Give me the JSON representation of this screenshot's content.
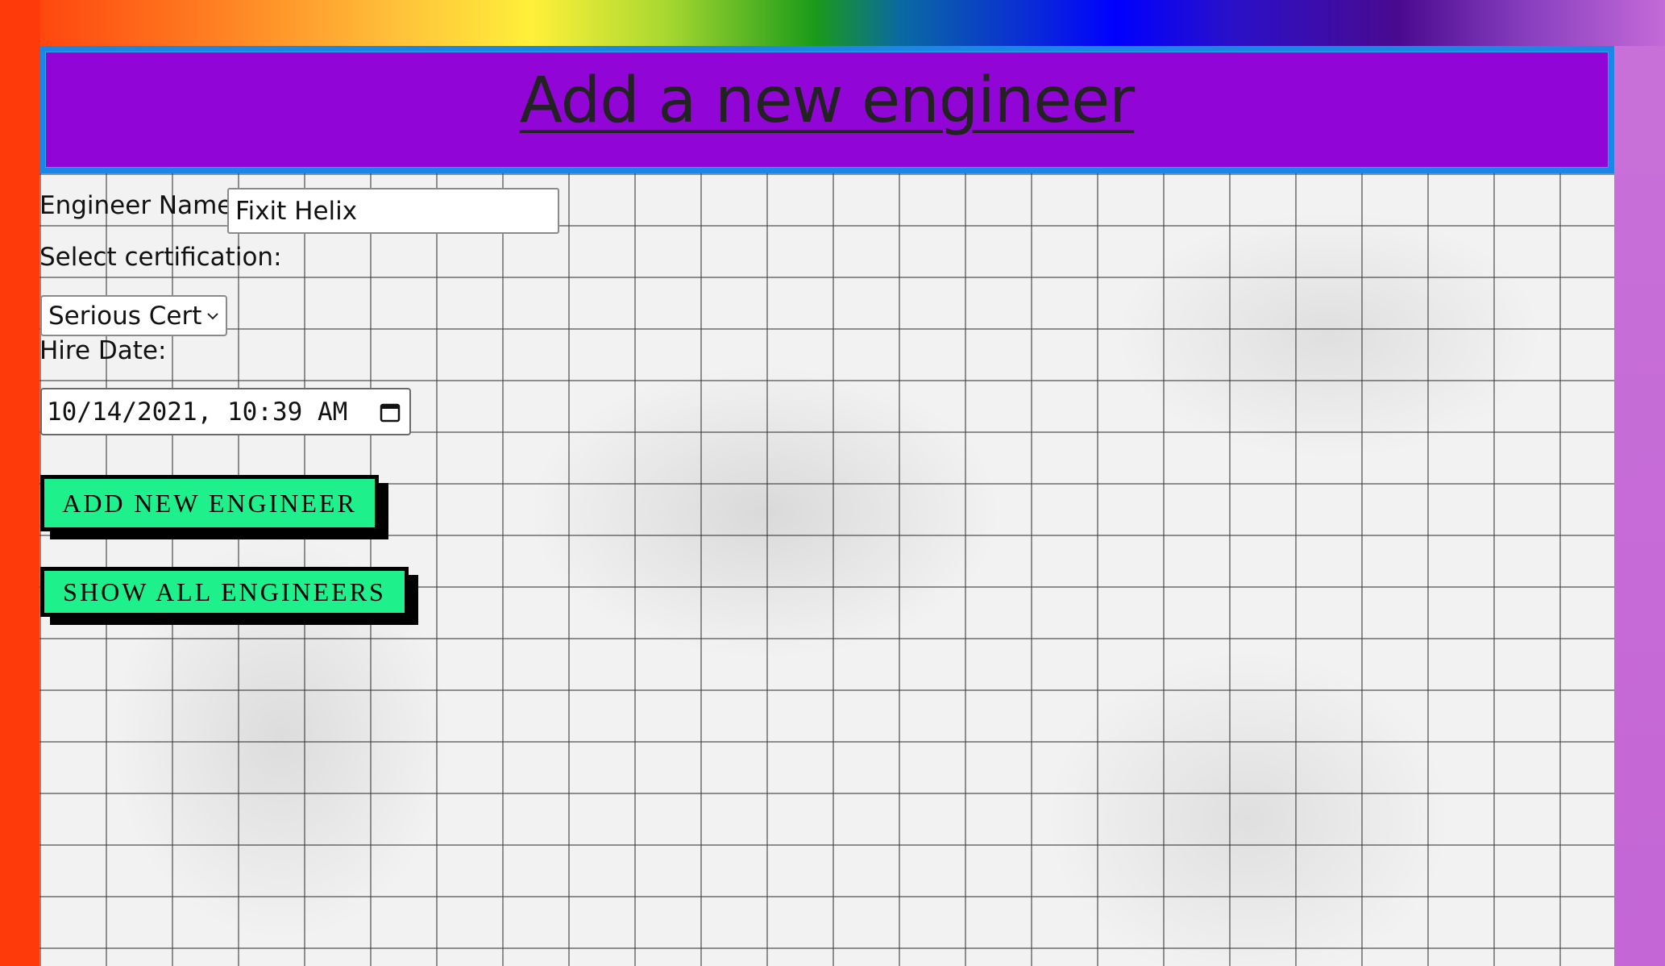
{
  "header": {
    "title": "Add a new engineer"
  },
  "form": {
    "name_label": "Engineer Name:",
    "name_value": "Fixit Helix",
    "cert_label": "Select certification:",
    "cert_selected": "Serious Cert",
    "hire_label": "Hire Date:",
    "hire_value": "10/14/2021, 10:39  AM"
  },
  "actions": {
    "add_label": "ADD NEW ENGINEER",
    "show_label": "SHOW ALL ENGINEERS"
  },
  "colors": {
    "header_bg": "#9106d6",
    "header_border": "#1a86e6",
    "button_bg": "#1ef08c",
    "left_stripe": "#ff3a0a",
    "right_stripe": "#c466d6"
  },
  "icons": {
    "select_chevron": "chevron-down-icon",
    "date_picker": "calendar-icon"
  }
}
